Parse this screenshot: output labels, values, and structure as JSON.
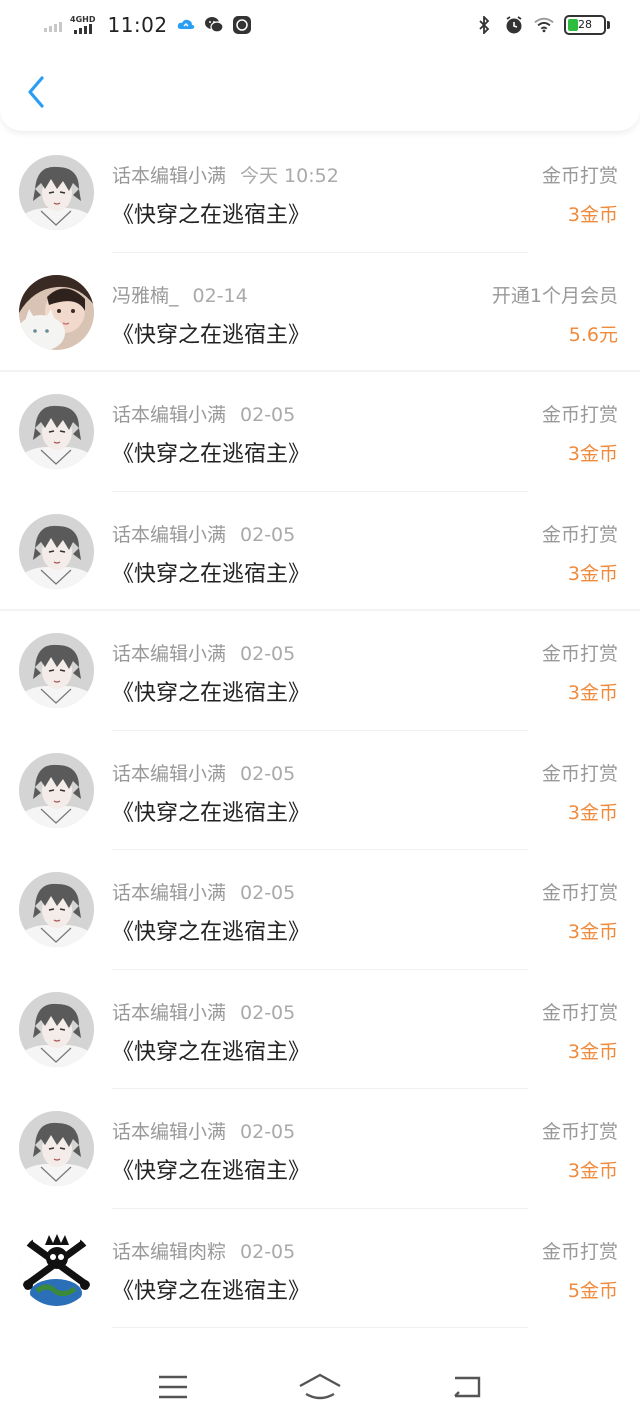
{
  "status_bar": {
    "network": "4GHD",
    "time": "11:02",
    "battery": "28",
    "battery_level": 0.28,
    "icons": [
      "signal-icon",
      "cloud-sync-icon",
      "wechat-icon",
      "app-notification-icon",
      "bluetooth-icon",
      "alarm-icon",
      "wifi-icon",
      "battery-icon"
    ]
  },
  "header": {
    "back_icon": "chevron-left-icon",
    "accent_color": "#2a9df4"
  },
  "colors": {
    "amount": "#f08a3c",
    "secondary_text": "#999999",
    "title_text": "#222222"
  },
  "records": [
    {
      "name": "话本编辑小满",
      "date": "今天 10:52",
      "title": "《快穿之在逃宿主》",
      "type": "金币打赏",
      "amount": "3金币",
      "avatar": "anime-avatar"
    },
    {
      "name": "冯雅楠_",
      "date": "02-14",
      "title": "《快穿之在逃宿主》",
      "type": "开通1个月会员",
      "amount": "5.6元",
      "avatar": "girl-cat-avatar"
    },
    {
      "name": "话本编辑小满",
      "date": "02-05",
      "title": "《快穿之在逃宿主》",
      "type": "金币打赏",
      "amount": "3金币",
      "avatar": "anime-avatar"
    },
    {
      "name": "话本编辑小满",
      "date": "02-05",
      "title": "《快穿之在逃宿主》",
      "type": "金币打赏",
      "amount": "3金币",
      "avatar": "anime-avatar"
    },
    {
      "name": "话本编辑小满",
      "date": "02-05",
      "title": "《快穿之在逃宿主》",
      "type": "金币打赏",
      "amount": "3金币",
      "avatar": "anime-avatar"
    },
    {
      "name": "话本编辑小满",
      "date": "02-05",
      "title": "《快穿之在逃宿主》",
      "type": "金币打赏",
      "amount": "3金币",
      "avatar": "anime-avatar"
    },
    {
      "name": "话本编辑小满",
      "date": "02-05",
      "title": "《快穿之在逃宿主》",
      "type": "金币打赏",
      "amount": "3金币",
      "avatar": "anime-avatar"
    },
    {
      "name": "话本编辑小满",
      "date": "02-05",
      "title": "《快穿之在逃宿主》",
      "type": "金币打赏",
      "amount": "3金币",
      "avatar": "anime-avatar"
    },
    {
      "name": "话本编辑小满",
      "date": "02-05",
      "title": "《快穿之在逃宿主》",
      "type": "金币打赏",
      "amount": "3金币",
      "avatar": "anime-avatar"
    },
    {
      "name": "话本编辑肉粽",
      "date": "02-05",
      "title": "《快穿之在逃宿主》",
      "type": "金币打赏",
      "amount": "5金币",
      "avatar": "skull-globe-avatar"
    }
  ],
  "nav_bar": {
    "items": [
      "menu-icon",
      "home-icon",
      "back-icon"
    ]
  }
}
